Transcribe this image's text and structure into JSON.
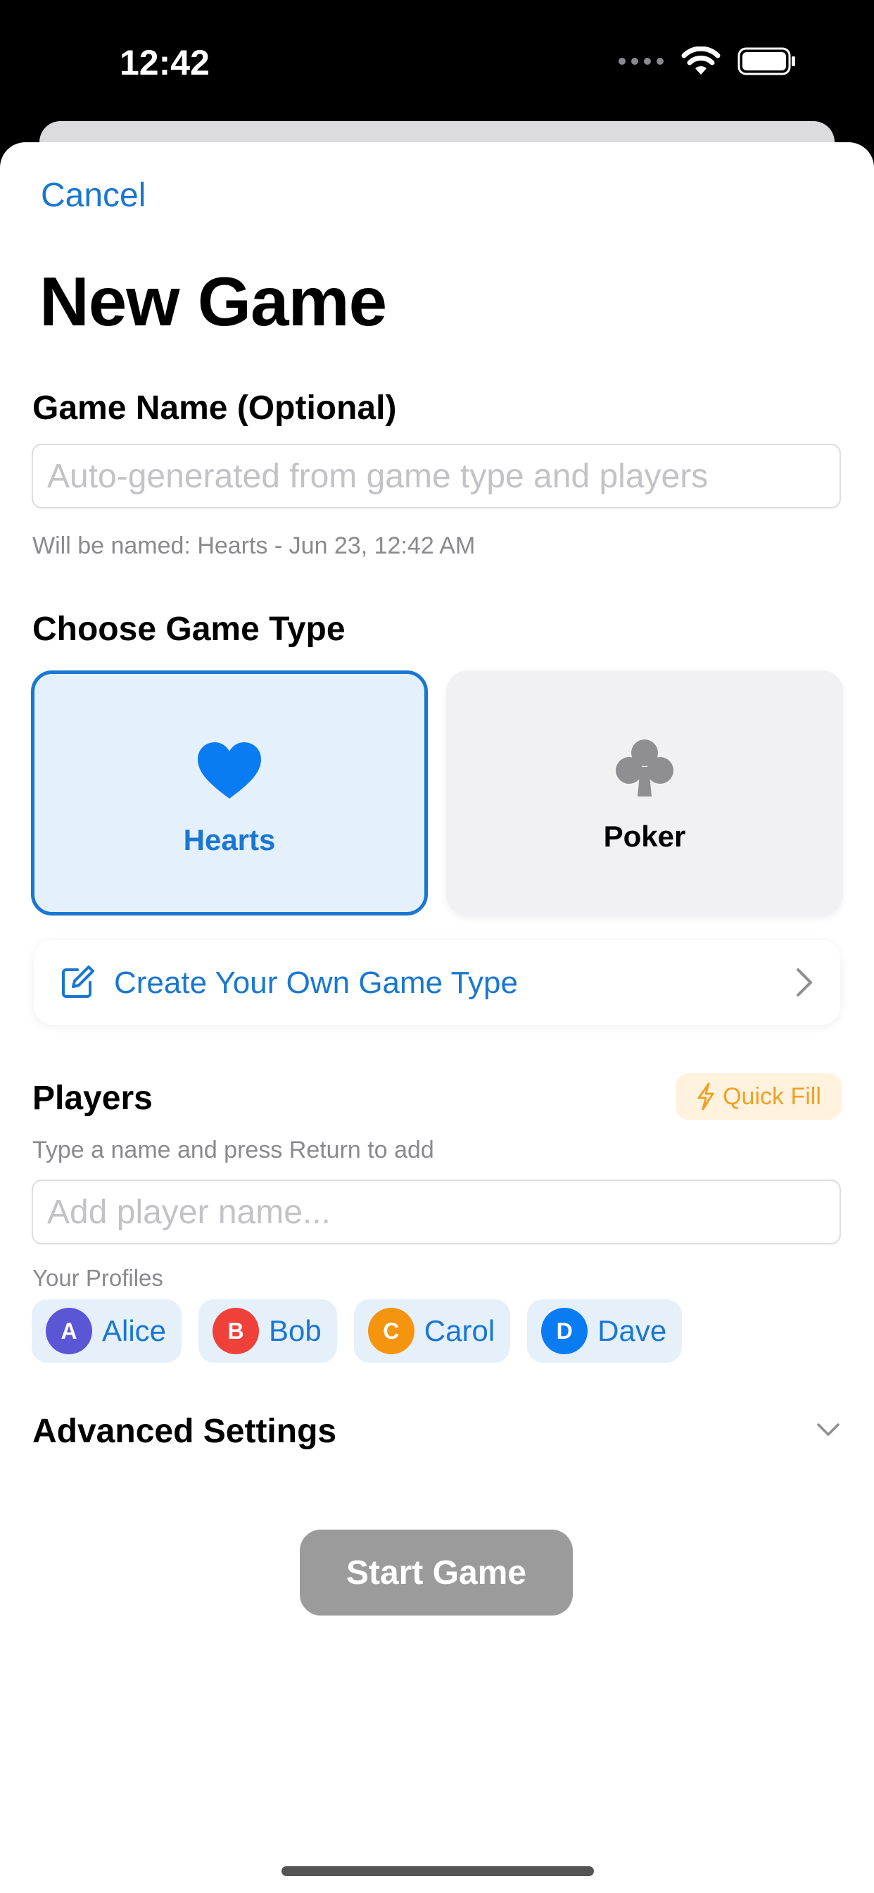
{
  "status_bar": {
    "time": "12:42",
    "icons": [
      "signal-dots-icon",
      "wifi-icon",
      "battery-icon"
    ]
  },
  "header": {
    "cancel_label": "Cancel",
    "title": "New Game"
  },
  "game_name": {
    "label": "Game Name (Optional)",
    "placeholder": "Auto-generated from game type and players",
    "value": "",
    "hint": "Will be named: Hearts - Jun 23, 12:42 AM"
  },
  "game_type": {
    "label": "Choose Game Type",
    "options": [
      {
        "label": "Hearts",
        "icon": "heart-icon",
        "selected": true
      },
      {
        "label": "Poker",
        "icon": "club-icon",
        "selected": false
      }
    ],
    "create_label": "Create Your Own Game Type"
  },
  "players": {
    "label": "Players",
    "quick_fill_label": "Quick Fill",
    "hint": "Type a name and press Return to add",
    "input_placeholder": "Add player name...",
    "profiles_label": "Your Profiles",
    "profiles": [
      {
        "initial": "A",
        "name": "Alice",
        "color": "#5a56d6"
      },
      {
        "initial": "B",
        "name": "Bob",
        "color": "#f0403a"
      },
      {
        "initial": "C",
        "name": "Carol",
        "color": "#f5950f"
      },
      {
        "initial": "D",
        "name": "Dave",
        "color": "#0a7cf3"
      }
    ]
  },
  "advanced": {
    "label": "Advanced Settings"
  },
  "start_button": {
    "label": "Start Game"
  },
  "colors": {
    "accent": "#1977d2",
    "heart": "#0a7cf3",
    "club": "#8e8e93",
    "quick_fill": "#f0a026",
    "disabled_button": "#9b9b9b"
  }
}
